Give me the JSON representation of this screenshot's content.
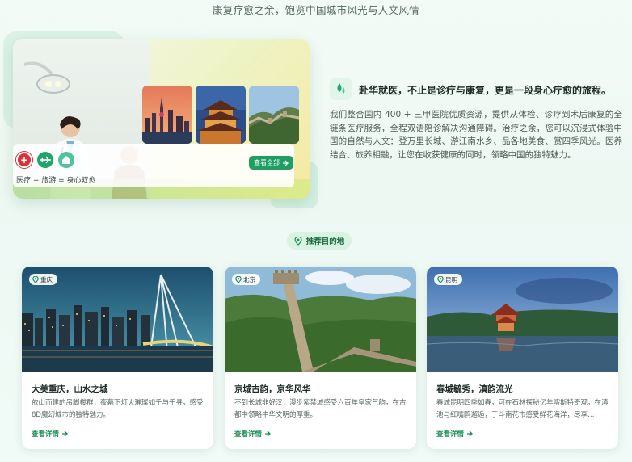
{
  "header": {
    "subtitle": "康复疗愈之余，饱览中国城市风光与人文风情"
  },
  "hero": {
    "caption": "医疗 + 旅游 = 身心双愈",
    "view_all_label": "查看全部",
    "icons": [
      "medical-cross-icon",
      "plane-icon",
      "home-icon"
    ]
  },
  "intro": {
    "title": "赴华就医，不止是诊疗与康复，更是一段身心疗愈的旅程。",
    "body": "我们整合国内 400 + 三甲医院优质资源，提供从体检、诊疗到术后康复的全链条医疗服务，全程双语陪诊解决沟通障碍。治疗之余，您可以沉浸式体验中国的自然与人文：登万里长城、游江南水乡、品各地美食、赏四季风光。医养结合、旅养相融，让您在收获健康的同时，领略中国的独特魅力。"
  },
  "section": {
    "badge_label": "推荐目的地"
  },
  "destinations": [
    {
      "tag": "重庆",
      "title": "大美重庆，山水之城",
      "description": "依山而建的吊脚楼群，夜幕下灯火璀璨如千与千寻，感受8D魔幻城市的独特魅力。",
      "link_label": "查看详情"
    },
    {
      "tag": "北京",
      "title": "京城古韵，京华风华",
      "description": "不到长城非好汉，漫步紫禁城感受六百年皇家气韵，在古都中领略中华文明的厚重。",
      "link_label": "查看详情"
    },
    {
      "tag": "昆明",
      "title": "春城毓秀，滇韵流光",
      "description": "春城昆明四季如春，可在石林探秘亿年喀斯特奇观，在滇池与红嘴鸥邂逅，于斗南花市感受鲜花海洋，尽享…",
      "link_label": "查看详情"
    }
  ],
  "colors": {
    "accent": "#1f9e63",
    "accent_light": "#d8f2e4",
    "medical_red": "#d8333a"
  }
}
